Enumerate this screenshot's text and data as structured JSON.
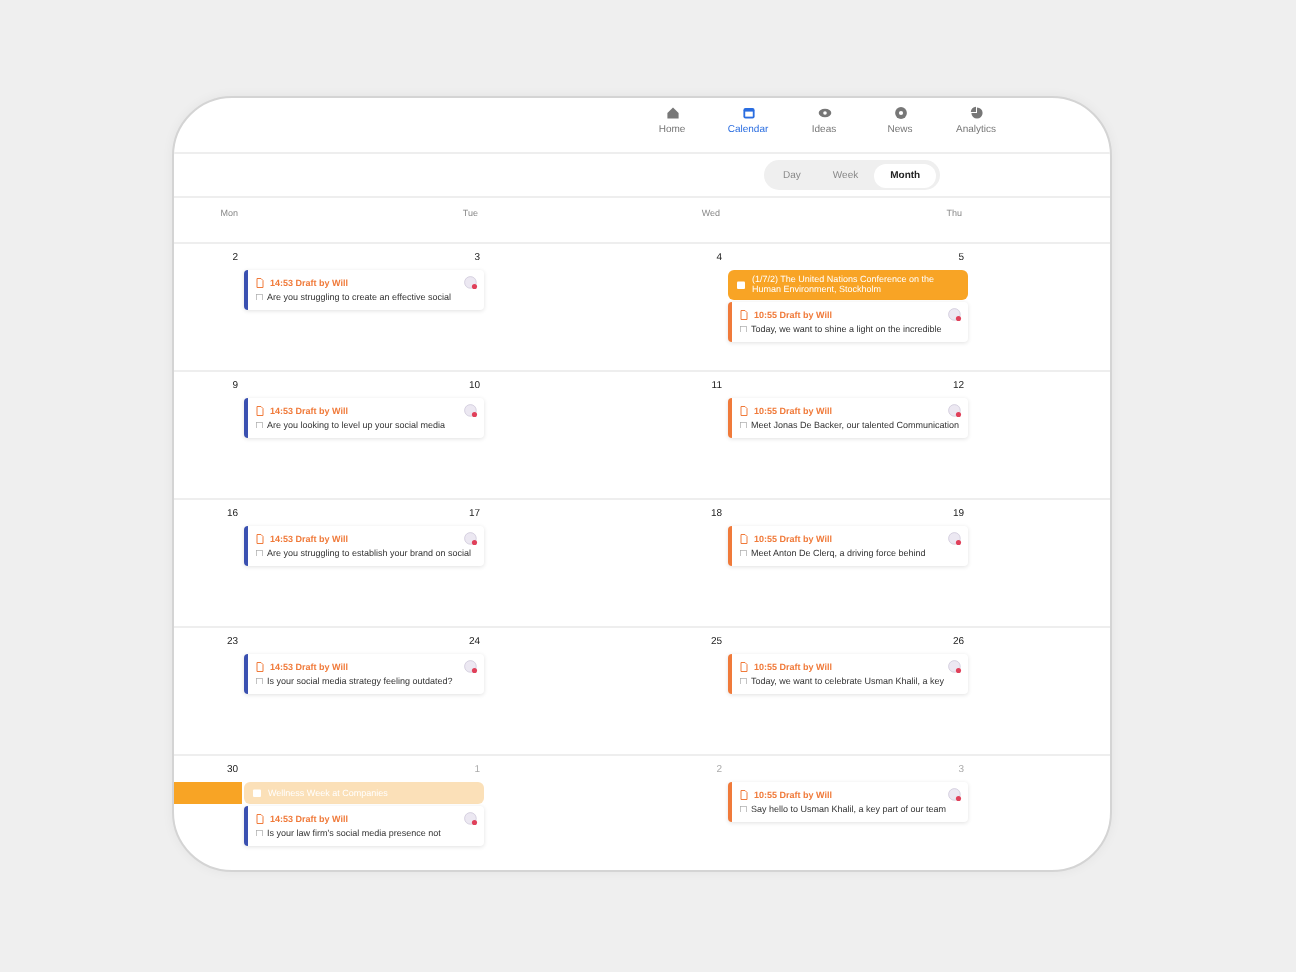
{
  "nav": [
    {
      "label": "Home",
      "kind": "home",
      "selected": false
    },
    {
      "label": "Calendar",
      "kind": "calendar",
      "selected": true
    },
    {
      "label": "Ideas",
      "kind": "eye",
      "selected": false
    },
    {
      "label": "News",
      "kind": "gear",
      "selected": false
    },
    {
      "label": "Analytics",
      "kind": "pie",
      "selected": false
    }
  ],
  "views": [
    {
      "label": "Day",
      "selected": false
    },
    {
      "label": "Week",
      "selected": false
    },
    {
      "label": "Month",
      "selected": true
    }
  ],
  "weekdays": [
    "Mon",
    "Tue",
    "Wed",
    "Thu"
  ],
  "weeks": [
    {
      "days": [
        {
          "date": "2",
          "other_month": false
        },
        {
          "date": "3",
          "other_month": false,
          "events": [
            {
              "time": "14:53 Draft by Will",
              "text": "Are you struggling to create an effective social",
              "color": "#3a50b0"
            }
          ]
        },
        {
          "date": "4",
          "other_month": false
        },
        {
          "date": "5",
          "other_month": false,
          "banners": [
            {
              "text": "(1/7/2) The United Nations Conference on the Human Environment, Stockholm",
              "faded": false
            }
          ],
          "events": [
            {
              "time": "10:55 Draft by Will",
              "text": "Today, we want to shine a light on the incredible",
              "color": "#f07a3a"
            }
          ]
        }
      ]
    },
    {
      "days": [
        {
          "date": "9",
          "other_month": false
        },
        {
          "date": "10",
          "other_month": false,
          "events": [
            {
              "time": "14:53 Draft by Will",
              "text": "Are you looking to level up your social media",
              "color": "#3a50b0"
            }
          ]
        },
        {
          "date": "11",
          "other_month": false
        },
        {
          "date": "12",
          "other_month": false,
          "events": [
            {
              "time": "10:55 Draft by Will",
              "text": "Meet Jonas De Backer, our talented Communication",
              "color": "#f07a3a"
            }
          ]
        }
      ]
    },
    {
      "days": [
        {
          "date": "16",
          "other_month": false
        },
        {
          "date": "17",
          "other_month": false,
          "events": [
            {
              "time": "14:53 Draft by Will",
              "text": "Are you struggling to establish your brand on social",
              "color": "#3a50b0"
            }
          ]
        },
        {
          "date": "18",
          "other_month": false
        },
        {
          "date": "19",
          "other_month": false,
          "events": [
            {
              "time": "10:55 Draft by Will",
              "text": "Meet Anton De Clerq, a driving force behind",
              "color": "#f07a3a"
            }
          ]
        }
      ]
    },
    {
      "days": [
        {
          "date": "23",
          "other_month": false
        },
        {
          "date": "24",
          "other_month": false,
          "events": [
            {
              "time": "14:53 Draft by Will",
              "text": "Is your social media strategy feeling outdated?",
              "color": "#3a50b0"
            }
          ]
        },
        {
          "date": "25",
          "other_month": false
        },
        {
          "date": "26",
          "other_month": false,
          "events": [
            {
              "time": "10:55 Draft by Will",
              "text": "Today, we want to celebrate Usman Khalil, a key",
              "color": "#f07a3a"
            }
          ]
        }
      ]
    },
    {
      "days": [
        {
          "date": "30",
          "other_month": false,
          "banners": [
            {
              "faded": false
            }
          ]
        },
        {
          "date": "1",
          "other_month": true,
          "banners": [
            {
              "text": "Wellness Week at Companies",
              "faded": true
            }
          ],
          "events": [
            {
              "time": "14:53 Draft by Will",
              "text": "Is your law firm's social media presence not",
              "color": "#3a50b0"
            }
          ]
        },
        {
          "date": "2",
          "other_month": true
        },
        {
          "date": "3",
          "other_month": true,
          "events": [
            {
              "time": "10:55 Draft by Will",
              "text": "Say hello to Usman Khalil, a key part of our team",
              "color": "#f07a3a"
            }
          ]
        }
      ]
    }
  ]
}
